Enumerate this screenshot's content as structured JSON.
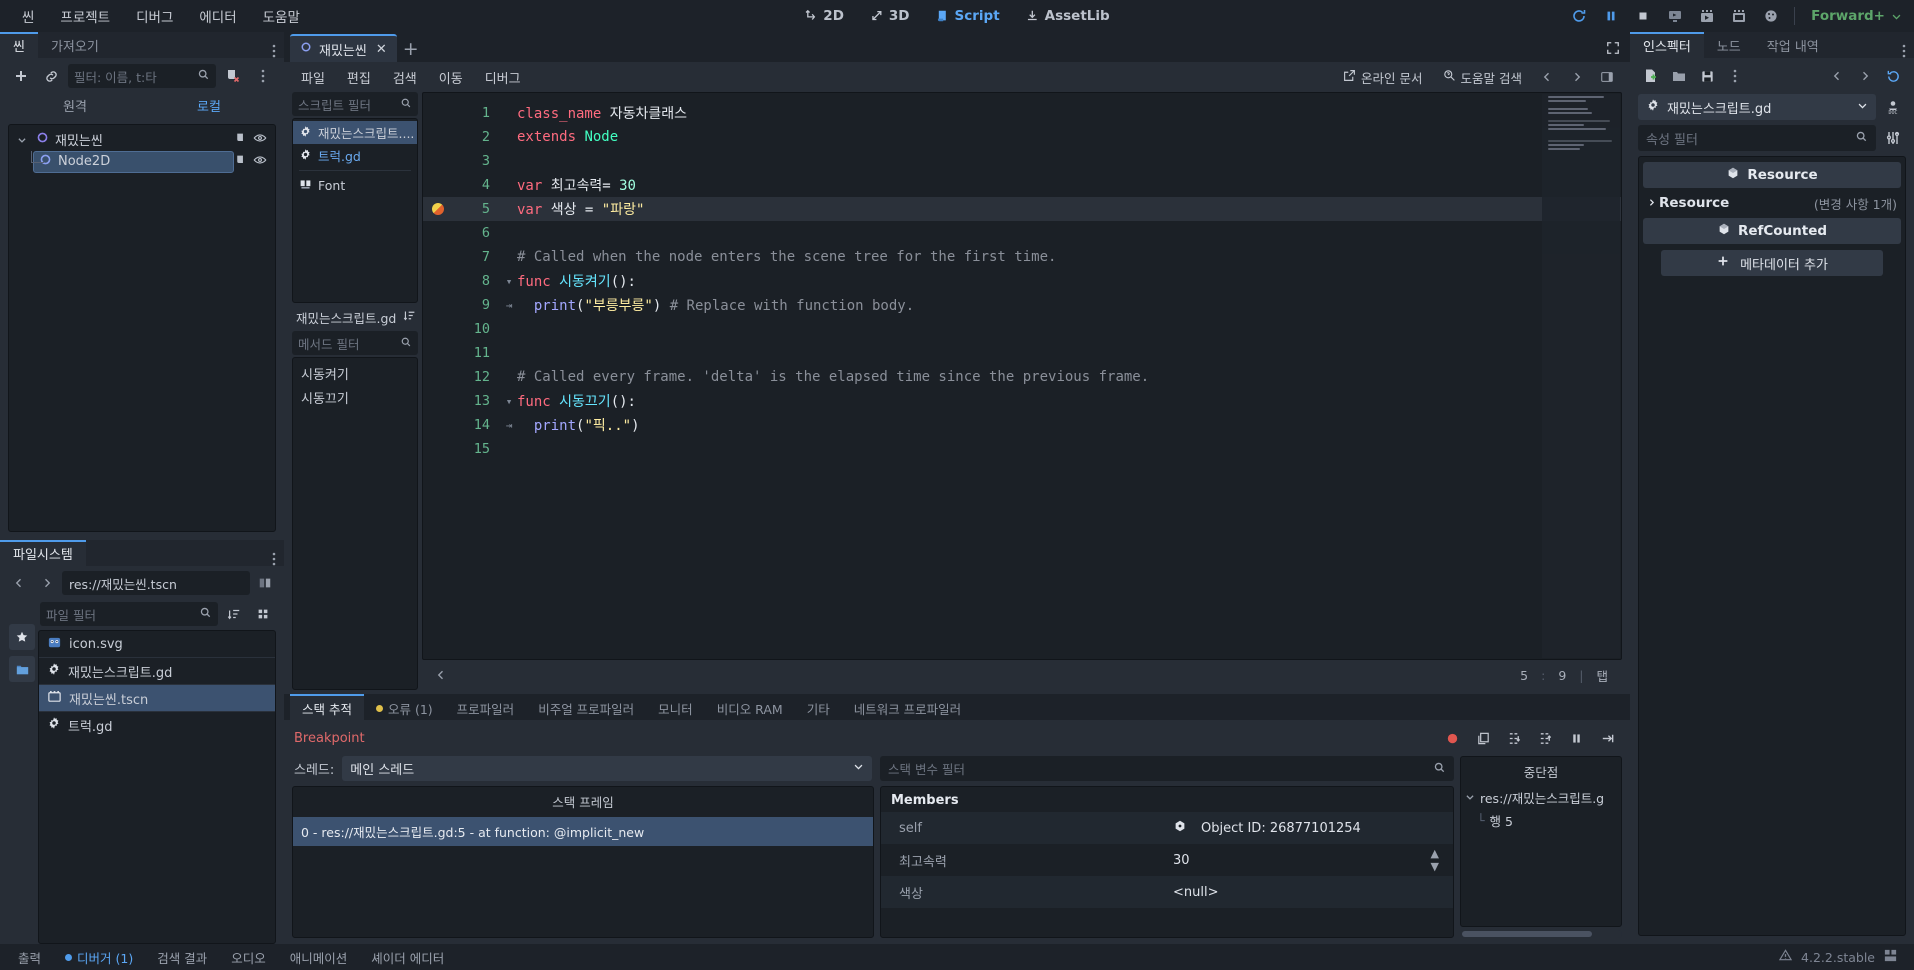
{
  "menubar": {
    "items": [
      "씬",
      "프로젝트",
      "디버그",
      "에디터",
      "도움말"
    ],
    "center_tabs": [
      {
        "label": "2D",
        "icon": "move-2d-icon",
        "active": false
      },
      {
        "label": "3D",
        "icon": "move-3d-icon",
        "active": false
      },
      {
        "label": "Script",
        "icon": "script-icon",
        "active": true
      },
      {
        "label": "AssetLib",
        "icon": "download-icon",
        "active": false
      }
    ],
    "playback": [
      {
        "icon": "reload-icon",
        "name": "run-project-button"
      },
      {
        "icon": "pause-icon",
        "name": "pause-button"
      },
      {
        "icon": "stop-icon",
        "name": "stop-button"
      },
      {
        "icon": "play-current-icon",
        "name": "play-current-scene-button"
      },
      {
        "icon": "movie-play-icon",
        "name": "play-custom-scene-button"
      },
      {
        "icon": "movie-write-icon",
        "name": "movie-maker-button"
      },
      {
        "icon": "remote-debug-icon",
        "name": "remote-debug-button"
      }
    ],
    "renderer": "Forward+"
  },
  "scene_dock": {
    "tabs": [
      {
        "label": "씬",
        "active": true
      },
      {
        "label": "가져오기",
        "active": false
      }
    ],
    "toolbar": {
      "add_node": "add-node-button",
      "instantiate": "link-icon",
      "filter_placeholder": "필터: 이름, t:타",
      "search_icon": "search-icon",
      "script_icon": "script-remove-icon",
      "more_icon": "vertical-dots-icon"
    },
    "remote_label": "원격",
    "local_label": "로컬",
    "tree": [
      {
        "label": "재밌는씬",
        "icon": "node2d-icon",
        "depth": 0,
        "selected": false,
        "expanded": true
      },
      {
        "label": "Node2D",
        "icon": "node2d-icon",
        "depth": 1,
        "selected": true,
        "expanded": false
      }
    ]
  },
  "filesystem_dock": {
    "tabs": [
      {
        "label": "파일시스템",
        "active": true
      }
    ],
    "path": "res://재밌는씬.tscn",
    "filter_placeholder": "파일 필터",
    "back_icon": "chevron-left-icon",
    "forward_icon": "chevron-right-icon",
    "favorites_icon": "star-icon",
    "folder_icon": "folder-icon",
    "sort_icon": "sort-icon",
    "layout_icon": "grid-icon",
    "files": [
      {
        "name": "icon.svg",
        "icon": "godot-icon",
        "selected": false
      },
      {
        "name": "재밌는스크립트.gd",
        "icon": "gdscript-icon",
        "selected": false
      },
      {
        "name": "재밌는씬.tscn",
        "icon": "packedscene-icon",
        "selected": true
      },
      {
        "name": "트럭.gd",
        "icon": "gdscript-icon",
        "selected": false
      }
    ]
  },
  "scene_tabs": {
    "tabs": [
      {
        "label": "재밌는씬",
        "icon": "node2d-icon",
        "active": true,
        "close": "✕"
      }
    ],
    "add_label": "+",
    "expand_icon": "expand-icon"
  },
  "script_editor": {
    "menu": [
      "파일",
      "편집",
      "검색",
      "이동",
      "디버그"
    ],
    "online_docs": "온라인 문서",
    "search_help": "도움말 검색",
    "online_docs_icon": "external-link-icon",
    "search_help_icon": "help-search-icon",
    "nav_prev_icon": "chevron-left-icon",
    "nav_next_icon": "chevron-right-icon",
    "panel_icon": "side-panel-icon",
    "script_filter_placeholder": "스크립트 필터",
    "script_list": [
      {
        "label": "재밌는스크립트....",
        "icon": "gdscript-icon",
        "selected": true,
        "link": false
      },
      {
        "label": "트럭.gd",
        "icon": "gdscript-icon",
        "selected": false,
        "link": true
      },
      {
        "label": "Font",
        "icon": "font-icon",
        "selected": false,
        "link": false
      }
    ],
    "member_header": "재밌는스크립트.gd",
    "member_header_icon": "sort-icon",
    "method_filter_placeholder": "메서드 필터",
    "members": [
      "시동켜기",
      "시동끄기"
    ],
    "status": {
      "line": "5",
      "colon": ":",
      "column": "9",
      "sep": "|",
      "tab_mode": "탭"
    },
    "code": [
      {
        "n": "1",
        "fold": "",
        "bp": false,
        "hl": false,
        "tokens": [
          {
            "t": "class_name ",
            "c": "kw"
          },
          {
            "t": "자동차클래스",
            "c": "ident"
          }
        ]
      },
      {
        "n": "2",
        "fold": "",
        "bp": false,
        "hl": false,
        "tokens": [
          {
            "t": "extends ",
            "c": "kw"
          },
          {
            "t": "Node",
            "c": "type"
          }
        ]
      },
      {
        "n": "3",
        "fold": "",
        "bp": false,
        "hl": false,
        "tokens": []
      },
      {
        "n": "4",
        "fold": "",
        "bp": false,
        "hl": false,
        "tokens": [
          {
            "t": "var ",
            "c": "kw"
          },
          {
            "t": "최고속력",
            "c": "ident"
          },
          {
            "t": "= ",
            "c": "ident"
          },
          {
            "t": "30",
            "c": "num"
          }
        ]
      },
      {
        "n": "5",
        "fold": "",
        "bp": true,
        "hl": true,
        "tokens": [
          {
            "t": "var ",
            "c": "kw"
          },
          {
            "t": "색상 ",
            "c": "ident"
          },
          {
            "t": "= ",
            "c": "ident"
          },
          {
            "t": "\"파랑\"",
            "c": "str"
          }
        ]
      },
      {
        "n": "6",
        "fold": "",
        "bp": false,
        "hl": false,
        "tokens": []
      },
      {
        "n": "7",
        "fold": "",
        "bp": false,
        "hl": false,
        "tokens": [
          {
            "t": "# Called when the node enters the scene tree for the first time.",
            "c": "comment"
          }
        ]
      },
      {
        "n": "8",
        "fold": "▾",
        "bp": false,
        "hl": false,
        "tokens": [
          {
            "t": "func ",
            "c": "kw"
          },
          {
            "t": "시동켜기",
            "c": "func"
          },
          {
            "t": "():",
            "c": "ident"
          }
        ]
      },
      {
        "n": "9",
        "fold": "⇥",
        "bp": false,
        "hl": false,
        "tokens": [
          {
            "t": "  ",
            "c": "ident"
          },
          {
            "t": "print",
            "c": "builtin"
          },
          {
            "t": "(",
            "c": "ident"
          },
          {
            "t": "\"부릉부릉\"",
            "c": "str"
          },
          {
            "t": ") ",
            "c": "ident"
          },
          {
            "t": "# Replace with function body.",
            "c": "comment"
          }
        ]
      },
      {
        "n": "10",
        "fold": "",
        "bp": false,
        "hl": false,
        "tokens": []
      },
      {
        "n": "11",
        "fold": "",
        "bp": false,
        "hl": false,
        "tokens": []
      },
      {
        "n": "12",
        "fold": "",
        "bp": false,
        "hl": false,
        "tokens": [
          {
            "t": "# Called every frame. 'delta' is the elapsed time since the previous frame.",
            "c": "comment"
          }
        ]
      },
      {
        "n": "13",
        "fold": "▾",
        "bp": false,
        "hl": false,
        "tokens": [
          {
            "t": "func ",
            "c": "kw"
          },
          {
            "t": "시동끄기",
            "c": "func"
          },
          {
            "t": "():",
            "c": "ident"
          }
        ]
      },
      {
        "n": "14",
        "fold": "⇥",
        "bp": false,
        "hl": false,
        "tokens": [
          {
            "t": "  ",
            "c": "ident"
          },
          {
            "t": "print",
            "c": "builtin"
          },
          {
            "t": "(",
            "c": "ident"
          },
          {
            "t": "\"픽..\"",
            "c": "str"
          },
          {
            "t": ")",
            "c": "ident"
          }
        ]
      },
      {
        "n": "15",
        "fold": "",
        "bp": false,
        "hl": false,
        "tokens": []
      }
    ]
  },
  "debugger": {
    "tabs": [
      {
        "label": "스택 추적",
        "active": true,
        "dot": null
      },
      {
        "label": "오류 (1)",
        "active": false,
        "dot": "#e0c04a"
      },
      {
        "label": "프로파일러",
        "active": false,
        "dot": null
      },
      {
        "label": "비주얼 프로파일러",
        "active": false,
        "dot": null
      },
      {
        "label": "모니터",
        "active": false,
        "dot": null
      },
      {
        "label": "비디오 RAM",
        "active": false,
        "dot": null
      },
      {
        "label": "기타",
        "active": false,
        "dot": null
      },
      {
        "label": "네트워크 프로파일러",
        "active": false,
        "dot": null
      }
    ],
    "breakpoint_label": "Breakpoint",
    "tools": [
      {
        "name": "record-button",
        "icon": "record-icon"
      },
      {
        "name": "copy-error-button",
        "icon": "copy-icon"
      },
      {
        "name": "step-into-button",
        "icon": "step-into-icon"
      },
      {
        "name": "step-over-button",
        "icon": "step-over-icon"
      },
      {
        "name": "break-button",
        "icon": "pause-icon"
      },
      {
        "name": "continue-button",
        "icon": "continue-icon"
      }
    ],
    "thread_label": "스레드:",
    "thread_value": "메인 스레드",
    "stack_frames_header": "스택 프레임",
    "stack_frames": [
      {
        "label": "0 - res://재밌는스크립트.gd:5 - at function: @implicit_new",
        "selected": true
      }
    ],
    "stack_var_filter_placeholder": "스택 변수 필터",
    "members_header": "Members",
    "members": [
      {
        "key": "self",
        "value": "Object ID: 26877101254",
        "icon": "object-icon",
        "spinner": false
      },
      {
        "key": "최고속력",
        "value": "30",
        "icon": null,
        "spinner": true
      },
      {
        "key": "색상",
        "value": "<null>",
        "icon": null,
        "spinner": false
      }
    ],
    "breakpoints_header": "중단점",
    "breakpoints_tree": [
      {
        "label": "res://재밌는스크립트.g",
        "depth": 0,
        "icon": "chevron-down-icon"
      },
      {
        "label": "행 5",
        "depth": 1,
        "icon": null
      }
    ]
  },
  "inspector": {
    "tabs": [
      {
        "label": "인스펙터",
        "active": true
      },
      {
        "label": "노드",
        "active": false
      },
      {
        "label": "작업 내역",
        "active": false
      }
    ],
    "toolbar": [
      {
        "name": "new-resource-button",
        "icon": "new-file-icon"
      },
      {
        "name": "load-resource-button",
        "icon": "folder-open-icon"
      },
      {
        "name": "save-resource-button",
        "icon": "save-icon"
      },
      {
        "name": "resource-menu-button",
        "icon": "vertical-dots-icon"
      },
      {
        "name": "history-back-button",
        "icon": "chevron-left-icon"
      },
      {
        "name": "history-forward-button",
        "icon": "chevron-right-icon"
      },
      {
        "name": "history-button",
        "icon": "history-icon"
      }
    ],
    "resource_name": "재밌는스크립트.gd",
    "resource_icon": "gdscript-icon",
    "open_docs_icon": "open-docs-icon",
    "property_filter_placeholder": "속성 필터",
    "object_tools_icon": "tools-icon",
    "categories": [
      {
        "type": "category",
        "label": "Resource",
        "icon": "resource-icon"
      },
      {
        "type": "group",
        "label": "Resource",
        "changes": "(변경 사항 1개)",
        "icon": "chevron-right-icon"
      },
      {
        "type": "category",
        "label": "RefCounted",
        "icon": "resource-icon"
      }
    ],
    "add_metadata_label": "메타데이터 추가",
    "add_metadata_icon": "plus-icon"
  },
  "statusbar": {
    "items": [
      {
        "label": "출력",
        "active": false,
        "dot": null
      },
      {
        "label": "디버거 (1)",
        "active": true,
        "dot": "#4f9bea"
      },
      {
        "label": "검색 결과",
        "active": false,
        "dot": null
      },
      {
        "label": "오디오",
        "active": false,
        "dot": null
      },
      {
        "label": "애니메이션",
        "active": false,
        "dot": null
      },
      {
        "label": "셰이더 에디터",
        "active": false,
        "dot": null
      }
    ],
    "version": "4.2.2.stable",
    "version_icon": "warning-icon",
    "layout_icon": "layout-icon"
  },
  "colors": {
    "accent": "#4f9bea",
    "panel": "#272d36",
    "dark": "#1b2026",
    "bg": "#1d2229",
    "selection": "#3c5270",
    "error": "#e0696a",
    "renderer": "#5da56a"
  }
}
